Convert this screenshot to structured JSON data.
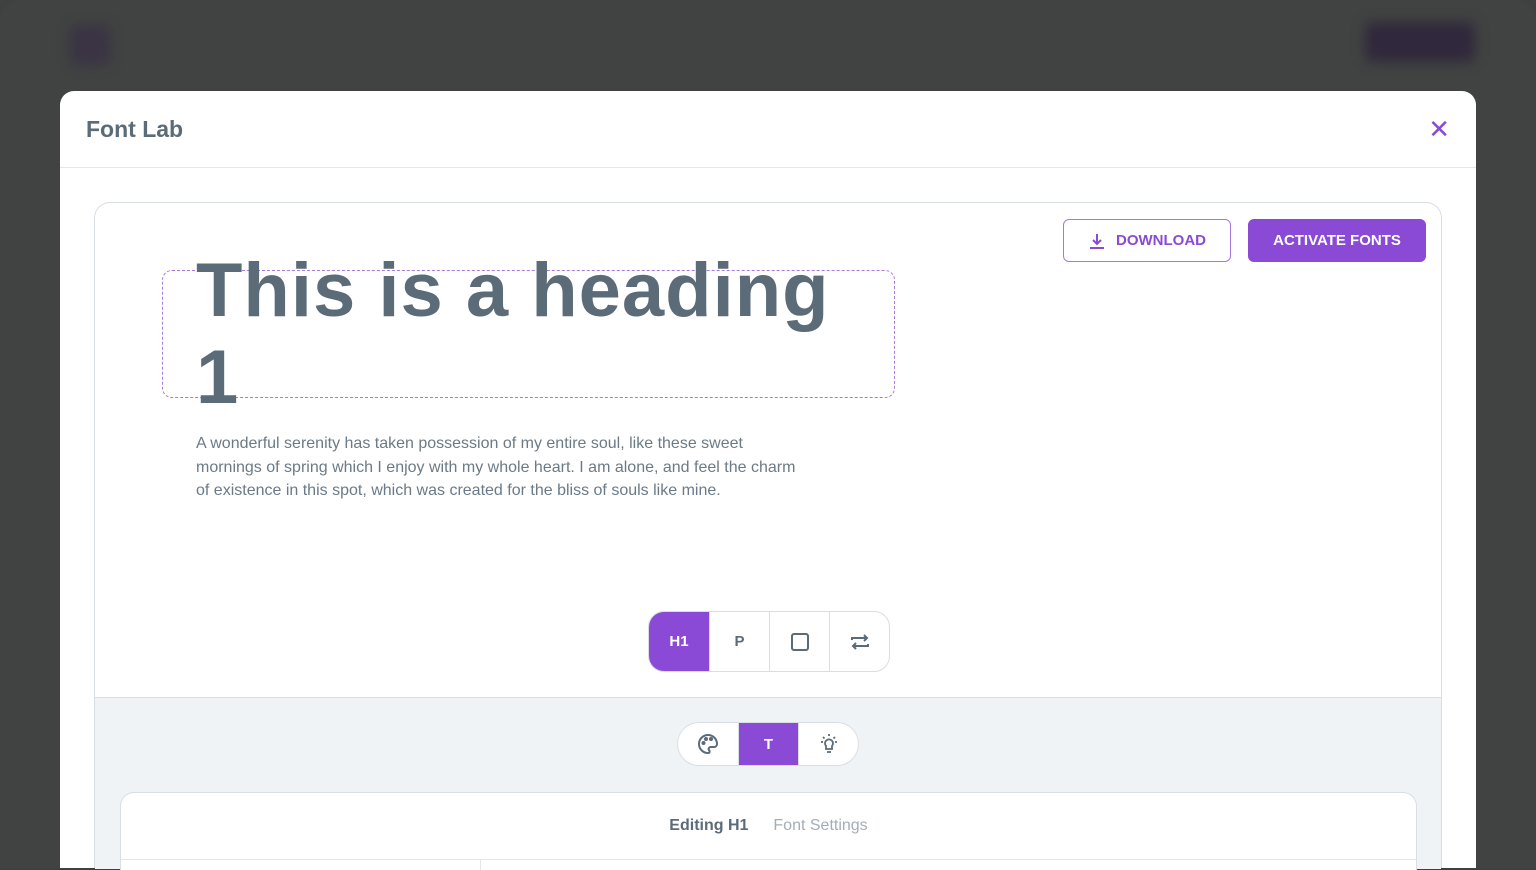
{
  "modal": {
    "title": "Font Lab",
    "close_icon": "close-icon"
  },
  "toolbar": {
    "download_label": "DOWNLOAD",
    "activate_label": "ACTIVATE FONTS"
  },
  "preview": {
    "heading": "This is a heading 1",
    "paragraph": "A wonderful serenity has taken possession of my entire soul, like these sweet mornings of spring which I enjoy with my whole heart. I am alone, and feel the charm of existence in this spot, which was created for the bliss of souls like mine."
  },
  "element_selector": {
    "items": [
      {
        "label": "H1",
        "active": true
      },
      {
        "label": "P",
        "active": false
      },
      {
        "icon": "square-icon"
      },
      {
        "icon": "swap-icon"
      }
    ]
  },
  "mode_selector": {
    "items": [
      {
        "icon": "palette-icon"
      },
      {
        "label": "T",
        "active": true
      },
      {
        "icon": "lightbulb-icon"
      }
    ]
  },
  "editor": {
    "tabs": [
      {
        "label": "Editing H1",
        "active": true
      },
      {
        "label": "Font Settings",
        "active": false
      }
    ]
  },
  "colors": {
    "accent": "#8a4ad6",
    "text": "#5b6b78"
  }
}
